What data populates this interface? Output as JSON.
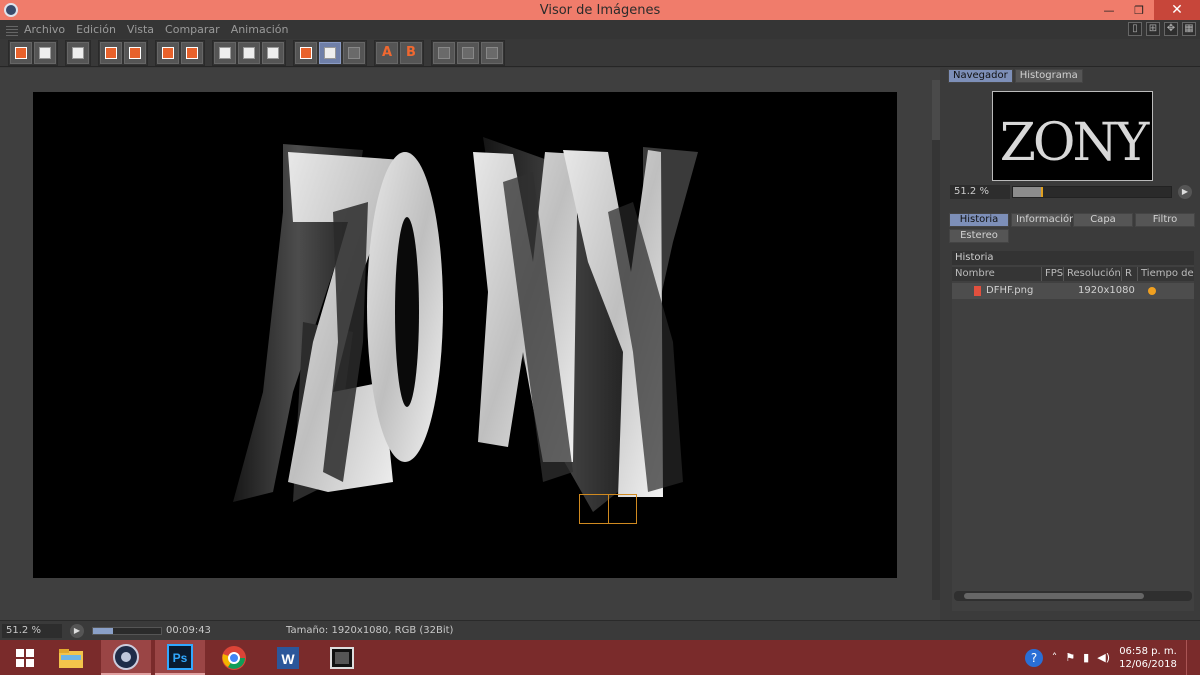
{
  "window": {
    "title": "Visor de Imágenes",
    "controls": [
      "minimize",
      "maximize",
      "close"
    ]
  },
  "menu": {
    "items": [
      "Archivo",
      "Edición",
      "Vista",
      "Comparar",
      "Animación"
    ]
  },
  "toolbar": {
    "groups": [
      [
        "open-icon",
        "save-icon"
      ],
      [
        "clapper-icon"
      ],
      [
        "render-icon",
        "render-region-icon"
      ],
      [
        "stop-icon",
        "layers-icon"
      ],
      [
        "view-a-icon",
        "view-b-icon",
        "view-ab-icon"
      ],
      [
        "compare-icon",
        "split-icon",
        "ab-icon"
      ],
      [
        "set-a-icon",
        "set-b-icon"
      ],
      [
        "grid-1-icon",
        "grid-2-icon",
        "grid-3-icon"
      ]
    ],
    "letter_a": "A",
    "letter_b": "B"
  },
  "image": {
    "text": "ZONY"
  },
  "navigator": {
    "tabs": [
      "Navegador",
      "Histograma"
    ],
    "active_tab": "Navegador",
    "thumb_text": "ZONY",
    "zoom_label": "51.2 %",
    "zoom_fraction": 0.18
  },
  "info_tabs": {
    "row1": [
      "Historia",
      "Información",
      "Capa",
      "Filtro"
    ],
    "row2": [
      "Estereo"
    ],
    "active_tab": "Historia"
  },
  "history": {
    "title": "Historia",
    "columns": [
      "Nombre",
      "FPS",
      "Resolución",
      "R",
      "Tiempo de"
    ],
    "rows": [
      {
        "name": "DFHF.png",
        "fps": "",
        "resolution": "1920x1080",
        "status_color": "#f0a020"
      }
    ]
  },
  "status": {
    "zoom": "51.2 %",
    "time": "00:09:43",
    "info": "Tamaño: 1920x1080, RGB (32Bit)",
    "progress_fraction": 0.3
  },
  "taskbar": {
    "apps": [
      "windows-start-icon",
      "file-explorer-icon",
      "cinema4d-icon",
      "photoshop-icon",
      "chrome-icon",
      "word-icon",
      "media-icon"
    ],
    "active_app": "cinema4d-icon",
    "photoshop_label": "Ps",
    "word_label": "W",
    "clock_time": "06:58 p. m.",
    "clock_date": "12/06/2018"
  }
}
